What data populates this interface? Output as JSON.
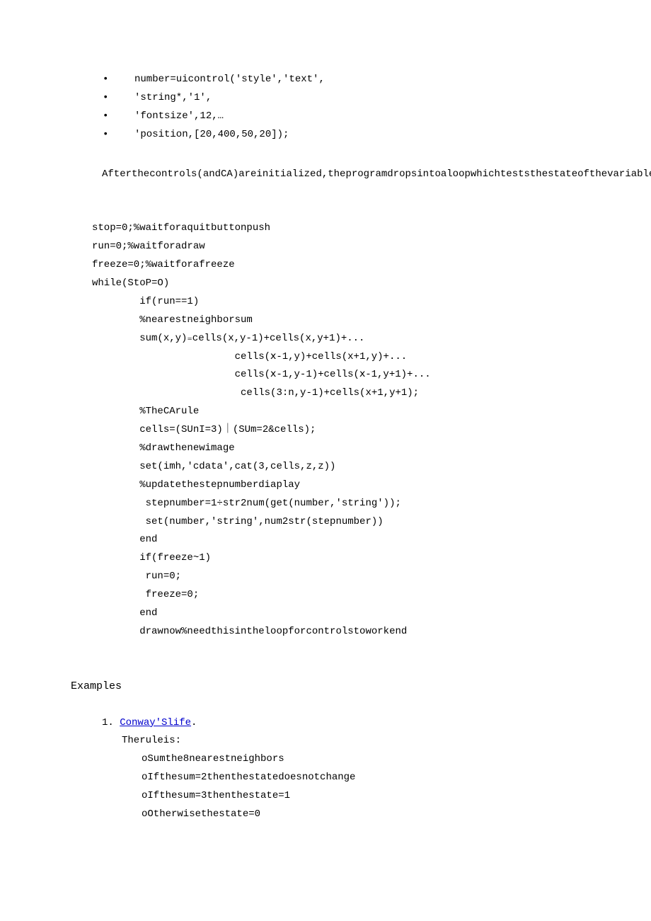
{
  "bullets": [
    "number=uicontrol('style','text',",
    "'string*,'1',",
    "'fontsize',12,…",
    "'position,[20,400,50,20]);"
  ],
  "paragraph": "Afterthecontrols(andCA)areinitialized,theprogramdropsintoaloopwhichteststhestateofthevariableswhicharesetinthecallbackfunctionsofeachbutton.Forthemoment,justlookatthenestedstructureofthewhileloopandifstatements.TheprogramloopsuntiltheQuitbuttonispushed.Theothertwobuttonscauseanifstatementtoexecutewhenpushed.",
  "code": {
    "l1": "stop=0;%waitforaquitbuttonpush",
    "l2": "run=0;%waitforadraw",
    "l3": "freeze=0;%waitforafreeze",
    "l4": "while(StoP=O)",
    "l5": "        if(run==1)",
    "l6": "        %nearestneighborsum",
    "l7": "        sum(x,y)₌cells(x,y-1)+cells(x,y+1)+...",
    "l8": "                        cells(ⅹ-1,y)+cells(x+1,y)+...",
    "l9": "                        cells(ⅹ-1,y-1)+cells(ⅹ-1,y+1)+...",
    "l10": "                         cells(3:n,y-1)+cells(x+1,y+1);",
    "l11": "        %TheCArule",
    "l12": "        cells=(SUnI=3)｜(SUm=2&cells);",
    "l13": "        %drawthenewimage",
    "l14": "        set(imh,'cdata',cat(3,cells,z,z))",
    "l15": "        %updatethestepnumberdiaplay",
    "l16": "         stepnumber=1÷str2num(get(number,'string'));",
    "l17": "         set(number,'string',num2str(stepnumber))",
    "l18": "        end",
    "l19": "        if(freeze~1)",
    "l20": "         run=0;",
    "l21": "         freeze=0;",
    "l22": "        end",
    "l23": "        drawnow%needthisintheloopforcontrolstoworkend"
  },
  "heading": "Examples",
  "example1": {
    "num": "1.",
    "link_text": "Conway'Slife",
    "period": ".",
    "rule_label": "Theruleis:",
    "rules": [
      "oSumthe8nearestneighbors",
      "oIfthesum=2thenthestatedoesnotchange",
      "oIfthesum=3thenthestate=1",
      "oOtherwisethestate=0"
    ]
  }
}
